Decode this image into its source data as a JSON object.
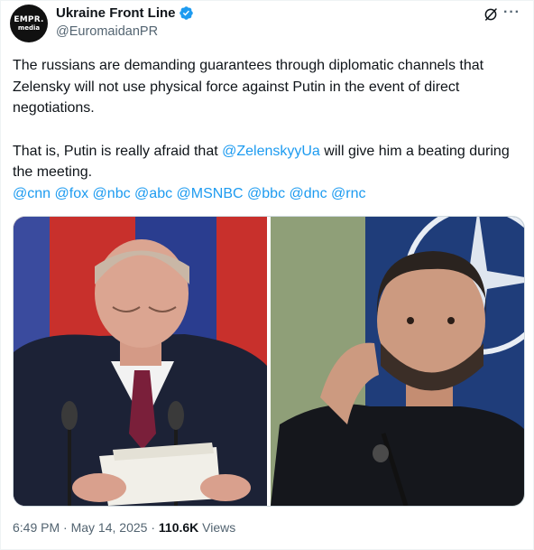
{
  "author": {
    "avatar_line1": "EMPR.",
    "avatar_line2": "media",
    "display_name": "Ukraine Front Line",
    "handle": "@EuromaidanPR"
  },
  "tweet": {
    "para1": "The russians are demanding guarantees through diplomatic channels that Zelensky will not use physical force against Putin in the event of direct negotiations.",
    "para2_before": "That is, Putin is really afraid that ",
    "para2_mention": "@ZelenskyyUa",
    "para2_after": " will give him a beating during the meeting.",
    "mentions": [
      "@cnn",
      "@fox",
      "@nbc",
      "@abc",
      "@MSNBC",
      "@bbc",
      "@dnc",
      "@rnc"
    ]
  },
  "meta": {
    "time": "6:49 PM",
    "separator": "·",
    "date": "May 14, 2025",
    "views_count": "110.6K",
    "views_label": "Views"
  },
  "colors": {
    "link": "#1d9bf0",
    "verified": "#1d9bf0",
    "secondary_text": "#536471"
  },
  "icons": [
    "verified-badge-icon",
    "grok-icon",
    "more-options-icon"
  ]
}
